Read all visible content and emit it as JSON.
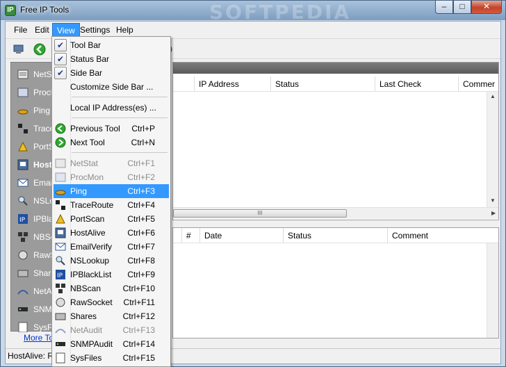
{
  "window": {
    "title": "Free IP Tools",
    "watermark": "SOFTPEDIA"
  },
  "caption": {
    "minimize": "–",
    "maximize": "□",
    "close": "✕"
  },
  "menubar": [
    "File",
    "Edit",
    "View",
    "Settings",
    "Help"
  ],
  "sidebar": {
    "items": [
      {
        "label": "NetSt",
        "icon": "netstat-icon"
      },
      {
        "label": "ProcM",
        "icon": "procmon-icon"
      },
      {
        "label": "Ping",
        "icon": "ping-icon"
      },
      {
        "label": "Trace",
        "icon": "traceroute-icon"
      },
      {
        "label": "PortS",
        "icon": "portscan-icon"
      },
      {
        "label": "HostA",
        "icon": "hostalive-icon"
      },
      {
        "label": "Email",
        "icon": "email-icon"
      },
      {
        "label": "NSLo",
        "icon": "nslookup-icon"
      },
      {
        "label": "IPBla",
        "icon": "ipblacklist-icon"
      },
      {
        "label": "NBSc",
        "icon": "nbscan-icon"
      },
      {
        "label": "RawS",
        "icon": "rawsocket-icon"
      },
      {
        "label": "Share",
        "icon": "shares-icon"
      },
      {
        "label": "NetA",
        "icon": "netaudit-icon"
      },
      {
        "label": "SNMP",
        "icon": "snmp-icon"
      },
      {
        "label": "SysFi",
        "icon": "sysfiles-icon"
      }
    ],
    "more_tools": "More Too"
  },
  "top_grid": {
    "columns": [
      "IP Address",
      "Status",
      "Last Check",
      "Commer"
    ]
  },
  "bottom_grid": {
    "columns": [
      "#",
      "Date",
      "Status",
      "Comment"
    ]
  },
  "statusbar": {
    "text": "HostAlive: R"
  },
  "scroll_thumb": "III",
  "view_menu": {
    "checked_items": [
      {
        "label": "Tool Bar"
      },
      {
        "label": "Status Bar"
      },
      {
        "label": "Side Bar"
      }
    ],
    "customize": "Customize Side Bar ...",
    "local_ip": "Local IP Address(es) ...",
    "nav": [
      {
        "label": "Previous Tool",
        "shortcut": "Ctrl+P"
      },
      {
        "label": "Next Tool",
        "shortcut": "Ctrl+N"
      }
    ],
    "tools": [
      {
        "label": "NetStat",
        "shortcut": "Ctrl+F1"
      },
      {
        "label": "ProcMon",
        "shortcut": "Ctrl+F2"
      },
      {
        "label": "Ping",
        "shortcut": "Ctrl+F3"
      },
      {
        "label": "TraceRoute",
        "shortcut": "Ctrl+F4"
      },
      {
        "label": "PortScan",
        "shortcut": "Ctrl+F5"
      },
      {
        "label": "HostAlive",
        "shortcut": "Ctrl+F6"
      },
      {
        "label": "EmailVerify",
        "shortcut": "Ctrl+F7"
      },
      {
        "label": "NSLookup",
        "shortcut": "Ctrl+F8"
      },
      {
        "label": "IPBlackList",
        "shortcut": "Ctrl+F9"
      },
      {
        "label": "NBScan",
        "shortcut": "Ctrl+F10"
      },
      {
        "label": "RawSocket",
        "shortcut": "Ctrl+F11"
      },
      {
        "label": "Shares",
        "shortcut": "Ctrl+F12"
      },
      {
        "label": "NetAudit",
        "shortcut": "Ctrl+F13"
      },
      {
        "label": "SNMPAudit",
        "shortcut": "Ctrl+F14"
      },
      {
        "label": "SysFiles",
        "shortcut": "Ctrl+F15"
      }
    ]
  },
  "colors": {
    "highlight": "#3399ff",
    "sidebar": "#9b9b9b",
    "titlebar": "#7d9dc0"
  }
}
